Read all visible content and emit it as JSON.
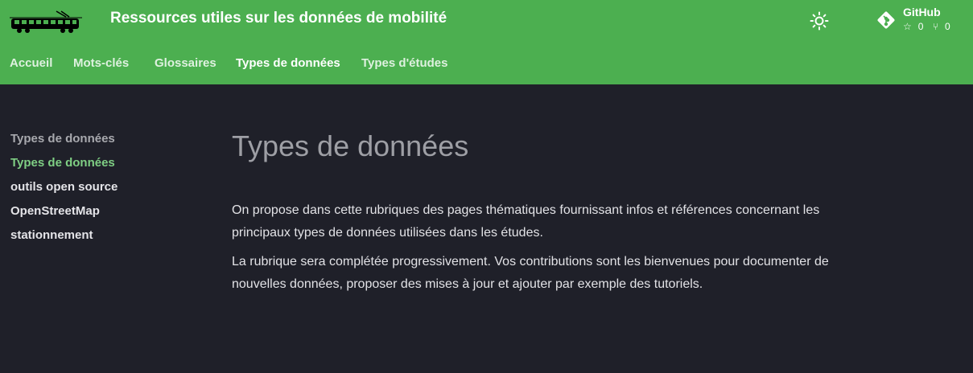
{
  "header": {
    "site_title": "Ressources utiles sur les données de mobilité",
    "logo_icon": "tram-icon",
    "theme_icon": "sun-icon",
    "repo": {
      "icon": "git-icon",
      "name": "GitHub",
      "stars": "0",
      "forks": "0"
    },
    "colors": {
      "primary": "#4caf50",
      "background": "#1f2029",
      "accent": "#7fcf84"
    }
  },
  "tabs": [
    {
      "label": "Accueil",
      "active": false
    },
    {
      "label": "Mots-clés",
      "active": false
    },
    {
      "label": "Glossaires",
      "active": false
    },
    {
      "label": "Types de données",
      "active": true
    },
    {
      "label": "Types d'études",
      "active": false
    }
  ],
  "sidebar": {
    "section_title": "Types de données",
    "items": [
      {
        "label": "Types de données",
        "active": true
      },
      {
        "label": "outils open source",
        "active": false
      },
      {
        "label": "OpenStreetMap",
        "active": false
      },
      {
        "label": "stationnement",
        "active": false
      }
    ]
  },
  "content": {
    "title": "Types de données",
    "paragraphs": [
      "On propose dans cette rubriques des pages thématiques fournissant infos et références concernant les principaux types de données utilisées dans les études.",
      "La rubrique sera complétée progressivement. Vos contributions sont les bienvenues pour documenter de nouvelles données, proposer des mises à jour et ajouter par exemple des tutoriels."
    ]
  }
}
